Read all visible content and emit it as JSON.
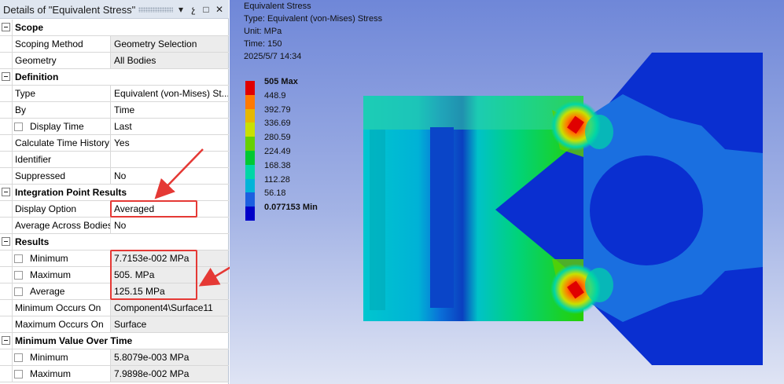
{
  "panel": {
    "title": "Details of \"Equivalent Stress\"",
    "pin_glyph": "↓",
    "pushpin_glyph": "չ",
    "close_glyph": "✕",
    "max_glyph": "□",
    "rows": [
      {
        "section": true,
        "label": "Scope"
      },
      {
        "label": "Scoping Method",
        "value": "Geometry Selection",
        "gray": true
      },
      {
        "label": "Geometry",
        "value": "All Bodies",
        "gray": true
      },
      {
        "section": true,
        "label": "Definition"
      },
      {
        "label": "Type",
        "value": "Equivalent (von-Mises) St..."
      },
      {
        "label": "By",
        "value": "Time"
      },
      {
        "label": "Display Time",
        "value": "Last",
        "checkbox": true
      },
      {
        "label": "Calculate Time History",
        "value": "Yes"
      },
      {
        "label": "Identifier",
        "value": ""
      },
      {
        "label": "Suppressed",
        "value": "No"
      },
      {
        "section": true,
        "label": "Integration Point Results"
      },
      {
        "label": "Display Option",
        "value": "Averaged"
      },
      {
        "label": "Average Across Bodies",
        "value": "No"
      },
      {
        "section": true,
        "label": "Results"
      },
      {
        "label": "Minimum",
        "value": "7.7153e-002 MPa",
        "checkbox": true,
        "gray": true
      },
      {
        "label": "Maximum",
        "value": "505. MPa",
        "checkbox": true,
        "gray": true
      },
      {
        "label": "Average",
        "value": "125.15 MPa",
        "checkbox": true,
        "gray": true
      },
      {
        "label": "Minimum Occurs On",
        "value": "Component4\\Surface11",
        "gray": true
      },
      {
        "label": "Maximum Occurs On",
        "value": "Surface",
        "gray": true
      },
      {
        "section": true,
        "label": "Minimum Value Over Time"
      },
      {
        "label": "Minimum",
        "value": "5.8079e-003 MPa",
        "checkbox": true,
        "gray": true
      },
      {
        "label": "Maximum",
        "value": "7.9898e-002 MPa",
        "checkbox": true,
        "gray": true
      }
    ]
  },
  "highlight_color": "#e53935",
  "viewport": {
    "info": [
      "Equivalent Stress",
      "Type: Equivalent (von-Mises) Stress",
      "Unit: MPa",
      "Time: 150",
      "2025/5/7 14:34"
    ],
    "legend": [
      {
        "label": "505 Max",
        "color": "#e00000",
        "bold": true
      },
      {
        "label": "448.9",
        "color": "#ff7a00"
      },
      {
        "label": "392.79",
        "color": "#e6b800"
      },
      {
        "label": "336.69",
        "color": "#c9e000"
      },
      {
        "label": "280.59",
        "color": "#66d000"
      },
      {
        "label": "224.49",
        "color": "#00c833"
      },
      {
        "label": "168.38",
        "color": "#00d6a6"
      },
      {
        "label": "112.28",
        "color": "#00b4d8"
      },
      {
        "label": "56.18",
        "color": "#1c5fe0"
      },
      {
        "label": "0.077153 Min",
        "color": "#0000c8",
        "bold": true
      }
    ]
  }
}
